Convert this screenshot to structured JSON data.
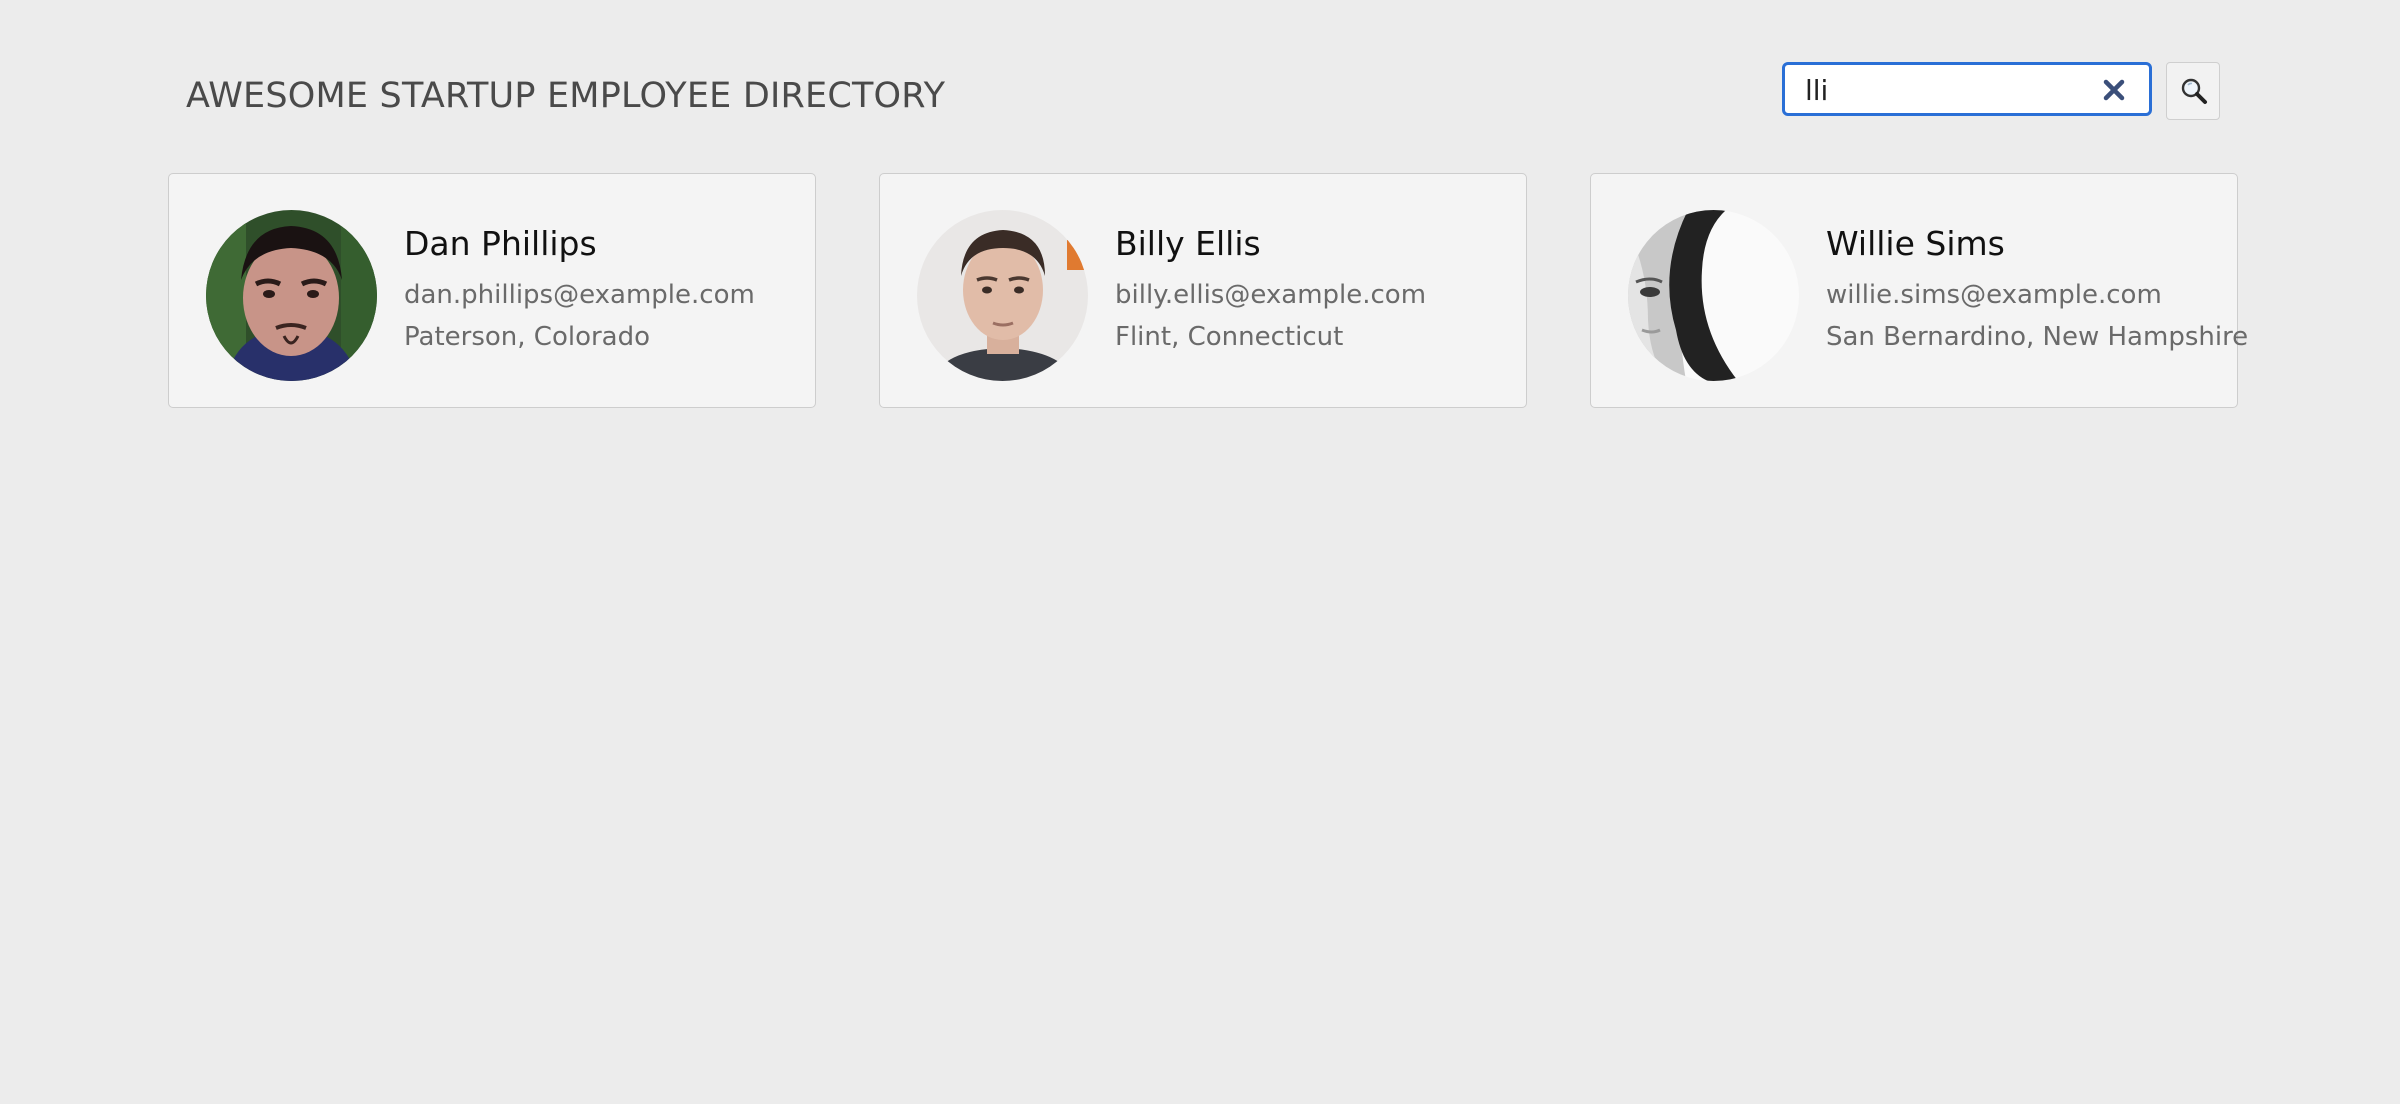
{
  "header": {
    "title": "AWESOME STARTUP EMPLOYEE DIRECTORY"
  },
  "search": {
    "value": "lli",
    "placeholder": "",
    "clear_icon": "close-icon",
    "button_icon": "search-icon"
  },
  "colors": {
    "background": "#ececec",
    "card_background": "#f4f4f4",
    "focus_border": "#2a6fd6",
    "clear_icon": "#3b4f7a"
  },
  "employees": [
    {
      "name": "Dan Phillips",
      "email": "dan.phillips@example.com",
      "location": "Paterson, Colorado",
      "avatar_icon": "avatar-photo"
    },
    {
      "name": "Billy Ellis",
      "email": "billy.ellis@example.com",
      "location": "Flint, Connecticut",
      "avatar_icon": "avatar-photo"
    },
    {
      "name": "Willie Sims",
      "email": "willie.sims@example.com",
      "location": "San Bernardino, New Hampshire",
      "avatar_icon": "avatar-photo"
    }
  ]
}
